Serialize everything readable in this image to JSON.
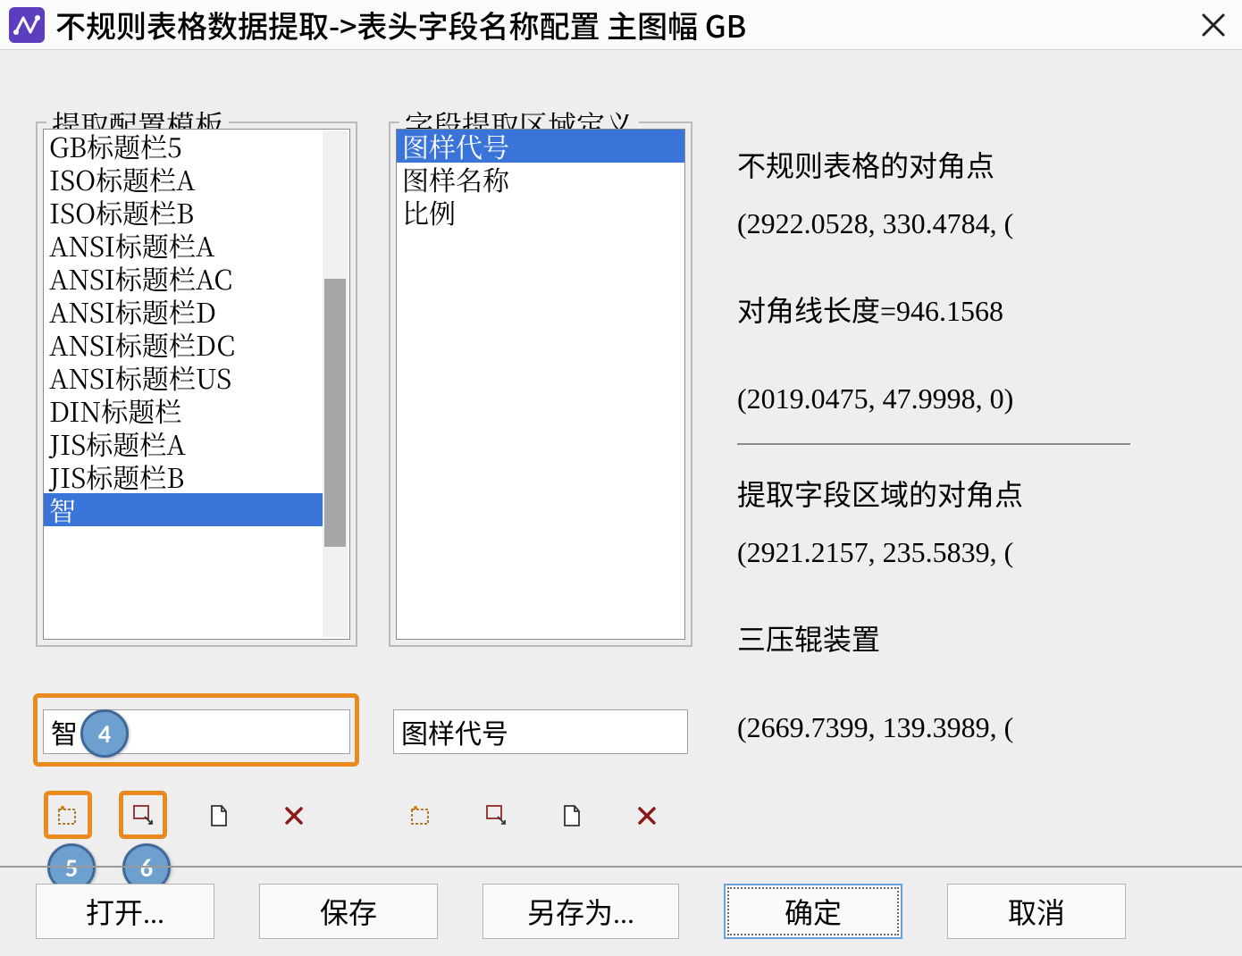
{
  "window": {
    "title": "不规则表格数据提取->表头字段名称配置 主图幅 GB"
  },
  "groups": {
    "templates_legend": "提取配置模板",
    "fields_legend": "字段提取区域定义"
  },
  "templates": {
    "items": [
      "GB标题栏5",
      "ISO标题栏A",
      "ISO标题栏B",
      "ANSI标题栏A",
      "ANSI标题栏AC",
      "ANSI标题栏D",
      "ANSI标题栏DC",
      "ANSI标题栏US",
      "DIN标题栏",
      "JIS标题栏A",
      "JIS标题栏B",
      "智"
    ],
    "selected_index": 11,
    "input_value": "智"
  },
  "fields": {
    "items": [
      "图样代号",
      "图样名称",
      "比例"
    ],
    "selected_index": 0,
    "input_value": "图样代号"
  },
  "info": {
    "table_corner_label": "不规则表格的对角点",
    "table_corner_pt1": "(2922.0528,  330.4784,  (",
    "diag_length": "对角线长度=946.1568",
    "table_corner_pt2": "(2019.0475,  47.9998,  0)",
    "field_corner_label": "提取字段区域的对角点",
    "field_corner_pt1": "(2921.2157,  235.5839,  (",
    "field_value": "三压辊装置",
    "field_corner_pt2": "(2669.7399,  139.3989,  ("
  },
  "toolbar_left": {
    "btn1": "pick-rect-icon",
    "btn2": "pick-point-icon",
    "btn3": "new-icon",
    "btn4": "delete-icon"
  },
  "toolbar_center": {
    "btn1": "pick-rect-icon",
    "btn2": "pick-point-icon",
    "btn3": "new-icon",
    "btn4": "delete-icon"
  },
  "buttons": {
    "open": "打开...",
    "save": "保存",
    "saveas": "另存为...",
    "ok": "确定",
    "cancel": "取消"
  },
  "callouts": {
    "c4": "4",
    "c5": "5",
    "c6": "6"
  }
}
